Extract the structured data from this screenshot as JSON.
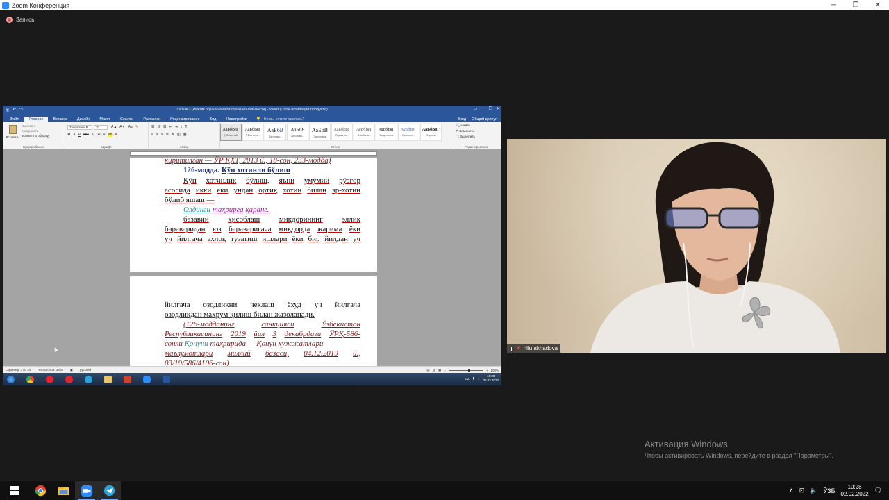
{
  "zoom": {
    "title": "Zoom Конференция",
    "recording_label": "Запись",
    "win_controls": {
      "minimize": "─",
      "restore": "❐",
      "close": "✕"
    }
  },
  "word": {
    "title": "УзбКЖЗ [Режим ограниченной функциональности] - Word (Сбой активации продукта)",
    "qat": [
      "🖫",
      "↶",
      "↷"
    ],
    "tabs": [
      "Файл",
      "Главная",
      "Вставка",
      "Дизайн",
      "Макет",
      "Ссылки",
      "Рассылки",
      "Рецензирование",
      "Вид",
      "Надстройки"
    ],
    "search_placeholder": "Что вы хотите сделать?",
    "right_actions": [
      "Вход",
      "Общий доступ"
    ],
    "ribbon": {
      "paste": "Вставить",
      "clipboard_items": [
        "Вырезать",
        "Копировать",
        "Формат по образцу"
      ],
      "font_name": "Times New R",
      "font_size": "20",
      "format_buttons": [
        "Ж",
        "К",
        "Ч",
        "abc",
        "x₂",
        "x²"
      ],
      "group_names": [
        "Буфер обмена",
        "Шрифт",
        "Абзац",
        "Стили",
        "Редактирование"
      ],
      "styles": [
        {
          "sample": "АаБбВвГ",
          "name": "¶ Обычный"
        },
        {
          "sample": "АаБбВвГ",
          "name": "¶ Без инте..."
        },
        {
          "sample": "АаБбВ",
          "name": "Заголово..."
        },
        {
          "sample": "АаБбВ",
          "name": "Заголово..."
        },
        {
          "sample": "АаБбВ",
          "name": "Заголовок"
        },
        {
          "sample": "АаБбВвГ",
          "name": "Подзагол..."
        },
        {
          "sample": "АаБбВвГ",
          "name": "Слабое в..."
        },
        {
          "sample": "АаБбВвГ",
          "name": "Выделение"
        },
        {
          "sample": "АаБбВвГ",
          "name": "Сильное..."
        },
        {
          "sample": "АаБбВвГ",
          "name": "Строгий"
        }
      ],
      "edit_items": [
        "Найти",
        "Заменить",
        "Выделить"
      ]
    },
    "page1": {
      "l1": "киритилган — ЎР ҚХТ, 2013 й., 18-сон, 233-модда)",
      "heading_a": "126-модда.",
      "heading_b": "Кўп хотинли бўлиш",
      "l3": [
        "Кўп",
        "хотинлик",
        "бўлиш,",
        "яъни",
        "умумий",
        "рўзғор"
      ],
      "l4": [
        "асосида",
        "икки",
        "ёки",
        "ундан",
        "ортиқ",
        "хотин",
        "билан",
        "эр-хотин"
      ],
      "l5": "бўлиб яшаш —",
      "l6_a": "Олдинги",
      "l6_b": "таҳрирга",
      "l6_c": "қаранг.",
      "l7": [
        "базавий",
        "ҳисоблаш",
        "миқдорининг",
        "эллик"
      ],
      "l8": [
        "бараваридан",
        "юз",
        "бараваригача",
        "миқдорда",
        "жарима",
        "ёки"
      ],
      "l9": [
        "уч",
        "йилгача",
        "ахлоқ",
        "тузатиш",
        "ишлари",
        "ёки",
        "бир",
        "йилдан",
        "уч"
      ]
    },
    "page2": {
      "l1": [
        "йилгача",
        "озодликни",
        "чеклаш",
        "ёхуд",
        "уч",
        "йилгача"
      ],
      "l2": "озодликдан маҳрум қилиш билан жазоланади.",
      "l3": [
        "(126-модданинг",
        "санкцияси",
        "Ўзбекистон"
      ],
      "l4": [
        "Республикасининг",
        "2019",
        "йил",
        "3",
        "декабрдаги",
        "ЎРҚ-586-"
      ],
      "l5_a": "сонли",
      "l5_b": "Қонуни",
      "l5_c": "таҳририда — Қонун ҳужжатлари",
      "l6": [
        "маълумотлари",
        "миллий",
        "базаси,",
        "04.12.2019",
        "й.,"
      ],
      "l7": "03/19/586/4106-сон)"
    },
    "status": {
      "page": "Страница 3 из 24",
      "words": "Число слов: 3408",
      "lang": "русский",
      "zoom": "100%"
    },
    "taskbar_time": "10:29",
    "taskbar_date": "02.02.2022",
    "taskbar_lang": "UZ"
  },
  "participant": {
    "name": "nilu akhadova"
  },
  "activation": {
    "title": "Активация Windows",
    "subtitle": "Чтобы активировать Windows, перейдите в раздел \"Параметры\"."
  },
  "os_taskbar": {
    "lang": "ЎЗБ",
    "time": "10:28",
    "date": "02.02.2022",
    "apps": [
      "chrome-icon",
      "file-explorer-icon",
      "zoom-icon",
      "telegram-icon"
    ]
  }
}
